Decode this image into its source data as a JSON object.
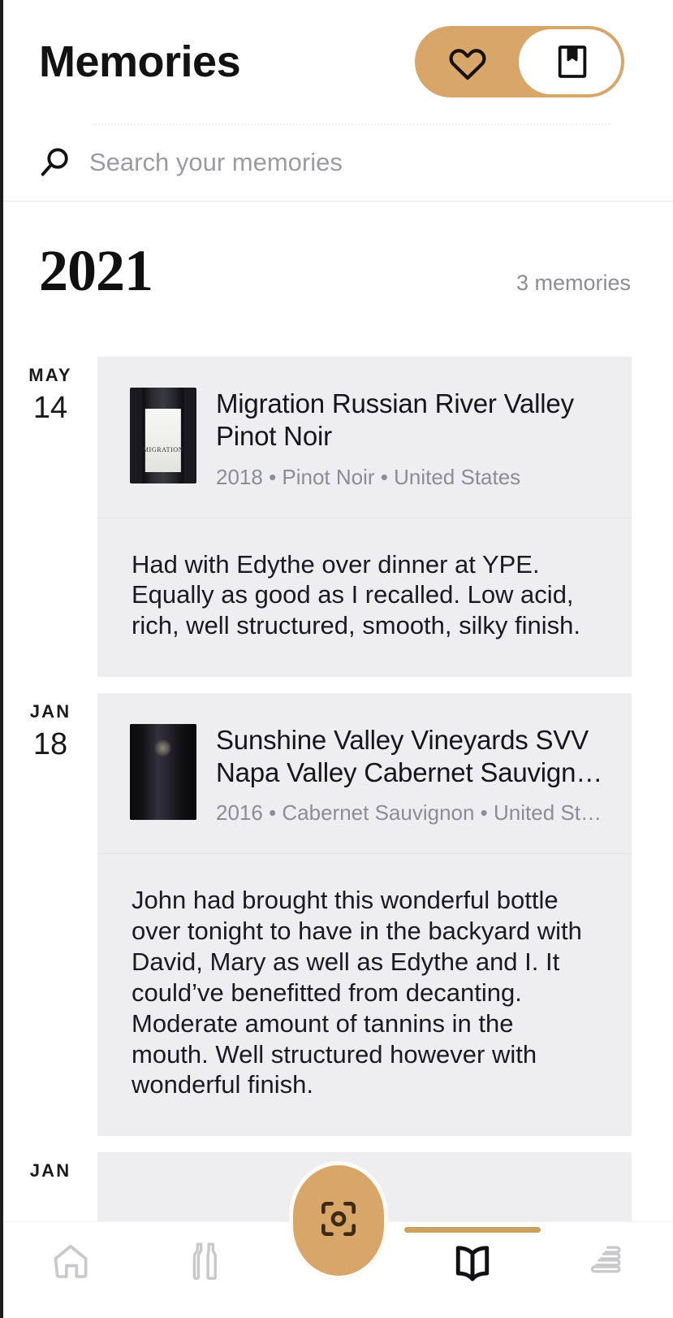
{
  "header": {
    "title": "Memories",
    "toggle": {
      "left_icon": "heart-icon",
      "right_icon": "bookmark-book-icon",
      "selected": "bookmark"
    }
  },
  "search": {
    "icon": "search-icon",
    "placeholder": "Search your memories",
    "value": ""
  },
  "timeline": {
    "year": "2021",
    "count_label": "3 memories",
    "entries": [
      {
        "month": "MAY",
        "day": "14",
        "thumb": "wine-bottle-migration-thumbnail",
        "thumb_label": "MIGRATION",
        "title": "Migration Russian River Valley Pinot Noir",
        "meta": "2018 • Pinot Noir • United States",
        "note": "Had with Edythe over dinner at YPE. Equally as good as I recalled. Low acid, rich, well structured, smooth, silky finish."
      },
      {
        "month": "JAN",
        "day": "18",
        "thumb": "wine-bottle-dark-photo-thumbnail",
        "thumb_label": "",
        "title": "Sunshine Valley Vineyards SVV Napa Valley Cabernet Sauvign…",
        "meta": "2016 • Cabernet Sauvignon • United St…",
        "note": "John had brought this wonderful bottle over tonight to have in the backyard with David, Mary as well as Edythe and I. It could’ve benefitted from decanting. Moderate amount of tannins in the mouth. Well structured however with wonderful finish."
      },
      {
        "month": "JAN",
        "day": "",
        "thumb": "wine-bottle-thumbnail",
        "thumb_label": "",
        "title": "",
        "meta": "",
        "note": ""
      }
    ]
  },
  "bottom_nav": {
    "items": [
      {
        "name": "home",
        "icon": "home-icon",
        "active": false
      },
      {
        "name": "bottles",
        "icon": "bottles-icon",
        "active": false
      },
      {
        "name": "scan",
        "icon": "scan-frame-icon",
        "active": false
      },
      {
        "name": "journal",
        "icon": "open-book-icon",
        "active": true
      },
      {
        "name": "cellar",
        "icon": "stacked-cellar-icon",
        "active": false
      }
    ]
  },
  "colors": {
    "amber": "#d8a668",
    "amber_indicator": "#cba161",
    "card_bg": "#eeeef0",
    "text_primary": "#15151a",
    "text_muted": "#8c8c93"
  }
}
